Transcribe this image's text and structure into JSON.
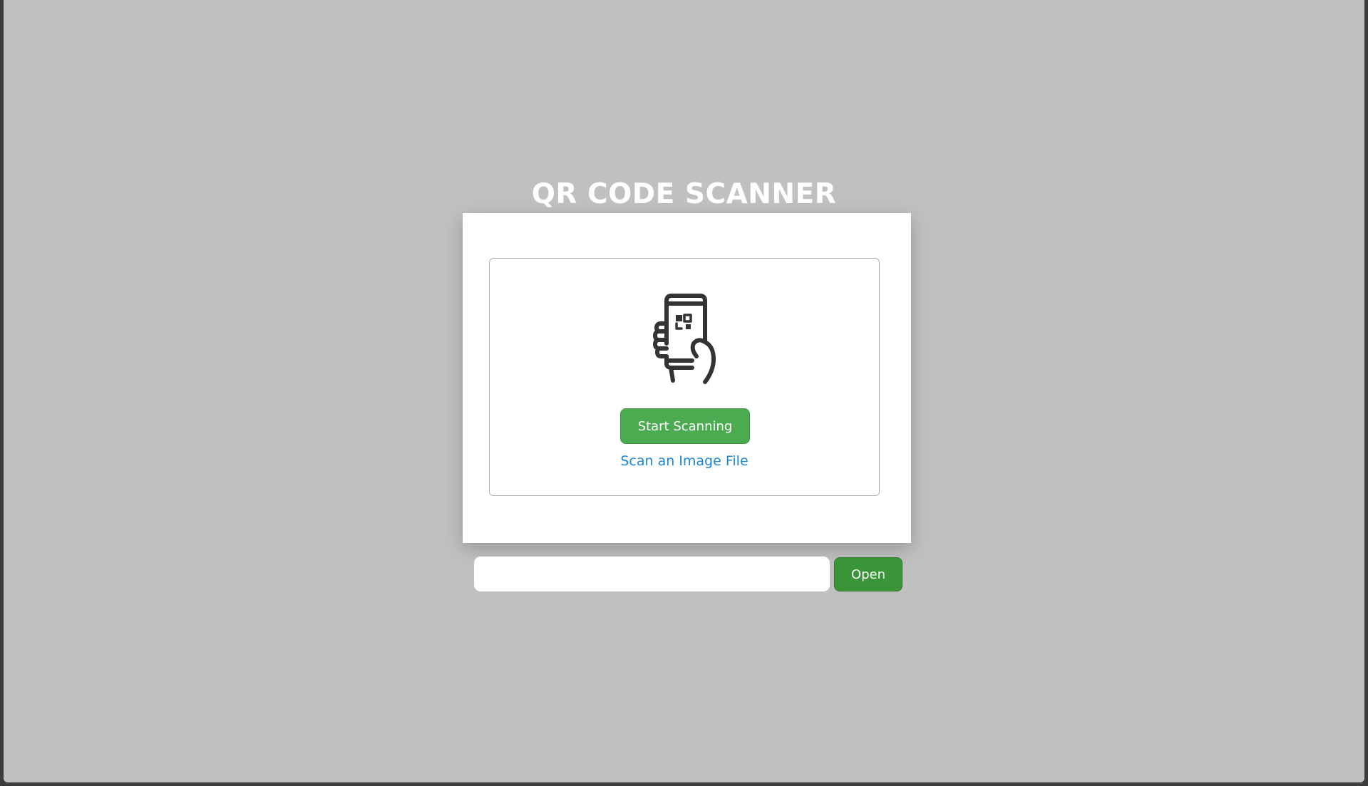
{
  "page": {
    "title": "QR CODE SCANNER"
  },
  "scanner": {
    "icon": "phone-qr-hand-icon",
    "start_button_label": "Start Scanning",
    "file_link_label": "Scan an Image File"
  },
  "url_bar": {
    "input_value": "",
    "input_placeholder": "",
    "open_button_label": "Open"
  },
  "colors": {
    "background": "#c0c0c0",
    "primary_button": "#4caa50",
    "open_button": "#3a9538",
    "link": "#1f87d1"
  }
}
